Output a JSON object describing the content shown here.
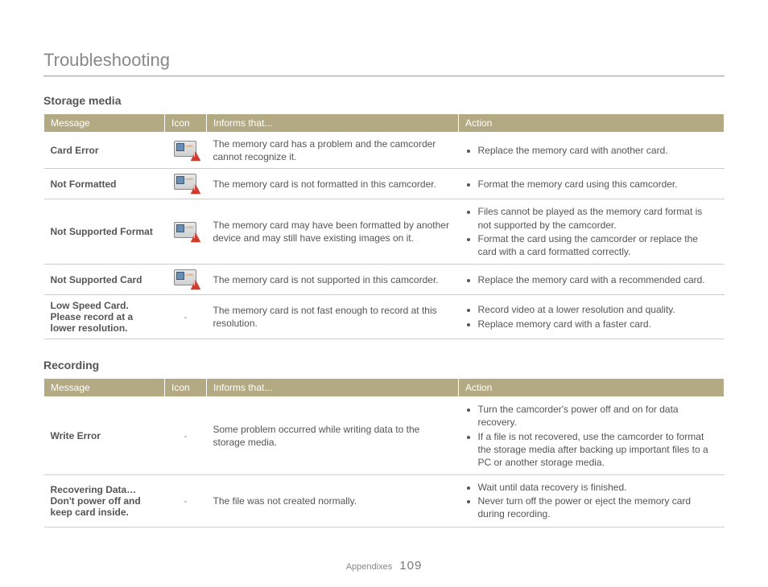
{
  "title": "Troubleshooting",
  "footer": {
    "label": "Appendixes",
    "page": "109"
  },
  "headers": {
    "message": "Message",
    "icon": "Icon",
    "informs": "Informs that...",
    "action": "Action"
  },
  "sections": [
    {
      "title": "Storage media",
      "rows": [
        {
          "message": "Card Error",
          "icon": "card-error",
          "informs": "The memory card has a problem and the camcorder cannot recognize it.",
          "actions": [
            "Replace the memory card with another card."
          ]
        },
        {
          "message": "Not Formatted",
          "icon": "card-error",
          "informs": "The memory card is not formatted in this camcorder.",
          "actions": [
            "Format the memory card using this camcorder."
          ]
        },
        {
          "message": "Not Supported Format",
          "icon": "card-error",
          "informs": "The memory card may have been formatted by another device and may still have existing images on it.",
          "actions": [
            "Files cannot be played as the memory card format is not supported by the camcorder.",
            "Format the card using the camcorder or replace the card with a card formatted correctly."
          ]
        },
        {
          "message": "Not Supported Card",
          "icon": "card-error",
          "informs": "The memory card is not supported in this camcorder.",
          "actions": [
            "Replace the memory card with a recommended card."
          ]
        },
        {
          "message": "Low Speed Card. Please record at a lower resolution.",
          "icon": "-",
          "informs": "The memory card is not fast enough to record at this resolution.",
          "actions": [
            "Record video at a lower resolution and quality.",
            "Replace memory card with a faster card."
          ]
        }
      ]
    },
    {
      "title": "Recording",
      "rows": [
        {
          "message": "Write Error",
          "icon": "-",
          "informs": "Some problem occurred while writing data to the storage media.",
          "actions": [
            "Turn the camcorder's power off and on for data recovery.",
            "If a file is not recovered, use the camcorder to format the storage media after backing up important files to a PC or another storage media."
          ]
        },
        {
          "message": "Recovering Data… Don't power off and keep card inside.",
          "icon": "-",
          "informs": "The file was not created normally.",
          "actions": [
            "Wait until data recovery is finished.",
            "Never turn off the power or eject the memory card during recording."
          ]
        }
      ]
    }
  ]
}
